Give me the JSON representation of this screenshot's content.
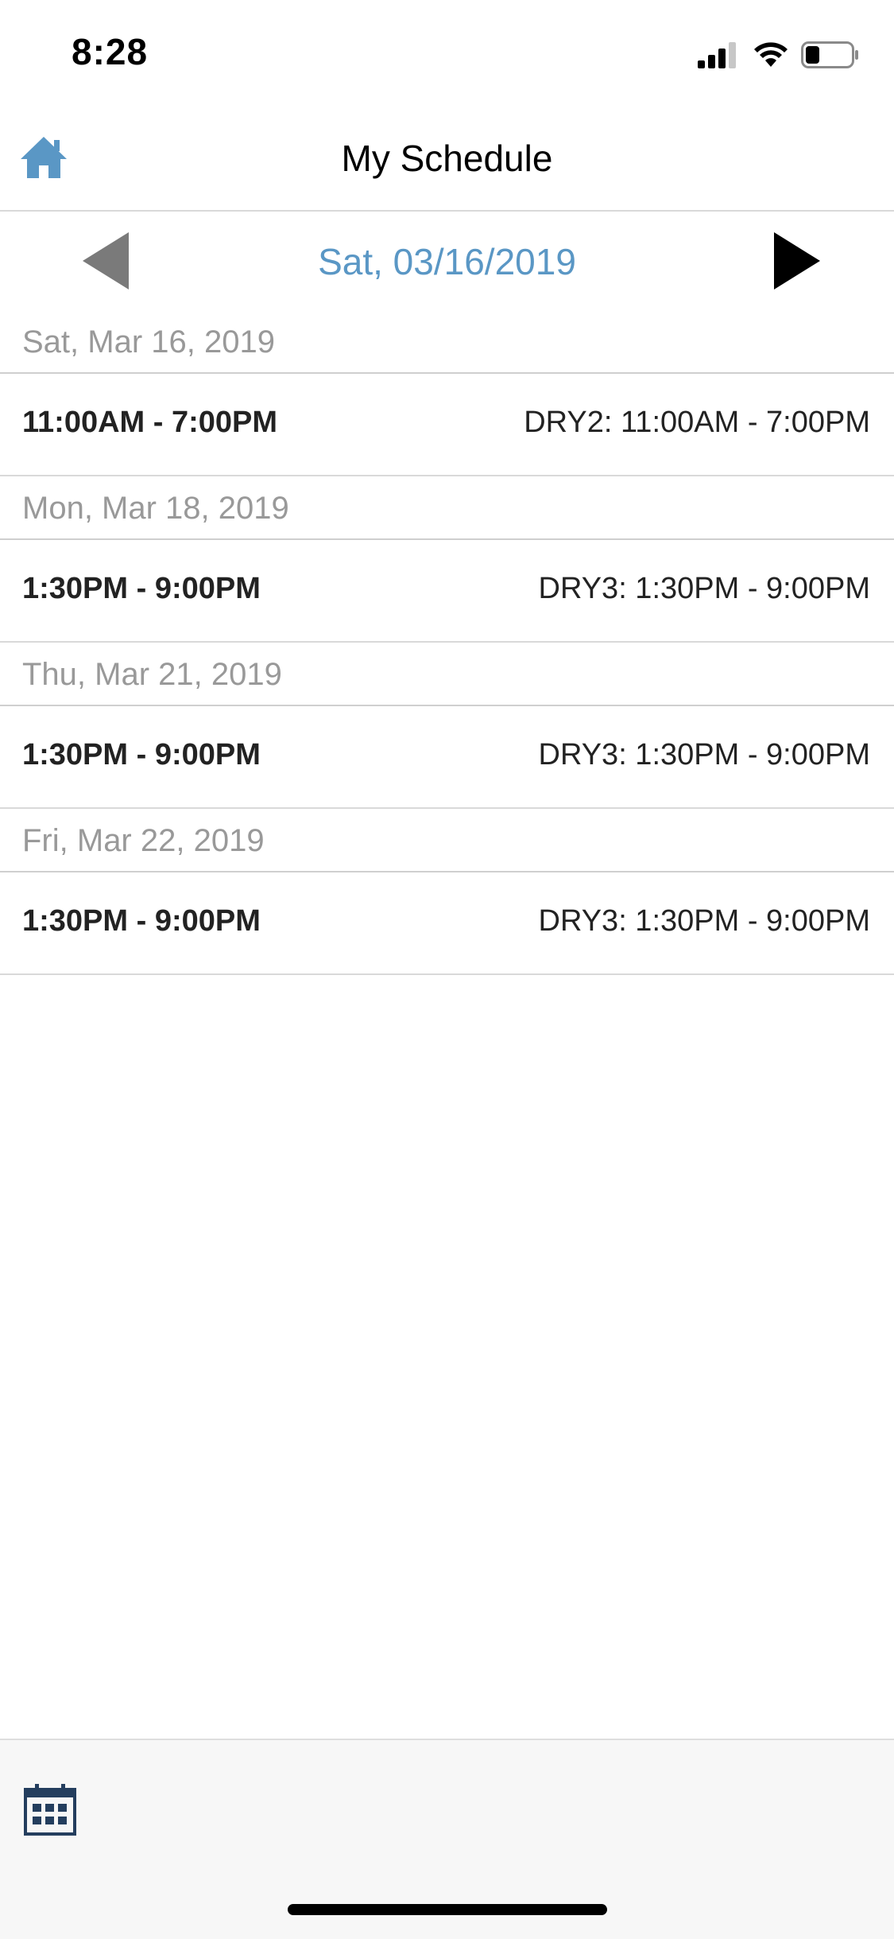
{
  "status_bar": {
    "time": "8:28",
    "signal_icon": "cellular-signal-icon",
    "wifi_icon": "wifi-icon",
    "battery_icon": "battery-icon"
  },
  "header": {
    "title": "My Schedule",
    "home_icon": "home-icon"
  },
  "date_nav": {
    "current_date": "Sat, 03/16/2019",
    "prev_icon": "triangle-left-icon",
    "next_icon": "triangle-right-icon"
  },
  "schedule": [
    {
      "date": "Sat, Mar 16, 2019",
      "time": "11:00AM - 7:00PM",
      "detail": "DRY2: 11:00AM - 7:00PM"
    },
    {
      "date": "Mon, Mar 18, 2019",
      "time": "1:30PM - 9:00PM",
      "detail": "DRY3: 1:30PM - 9:00PM"
    },
    {
      "date": "Thu, Mar 21, 2019",
      "time": "1:30PM - 9:00PM",
      "detail": "DRY3: 1:30PM - 9:00PM"
    },
    {
      "date": "Fri, Mar 22, 2019",
      "time": "1:30PM - 9:00PM",
      "detail": "DRY3: 1:30PM - 9:00PM"
    }
  ],
  "toolbar": {
    "calendar_icon": "calendar-icon"
  },
  "colors": {
    "accent": "#5a97c5",
    "date_header_text": "#999999",
    "divider": "#cfcfcf",
    "toolbar_bg": "#f7f7f7"
  }
}
